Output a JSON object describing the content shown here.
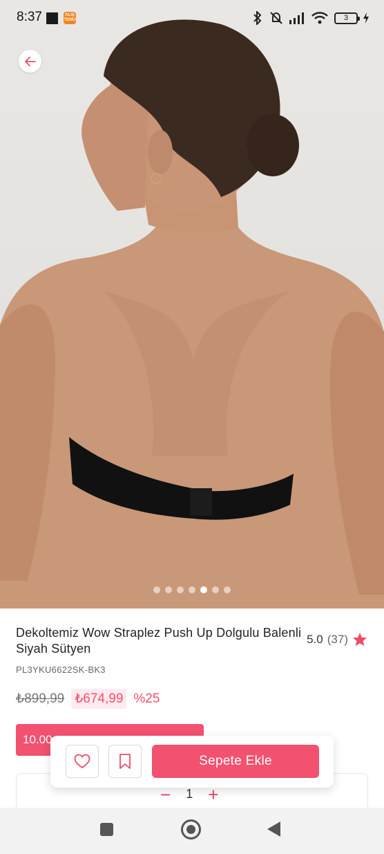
{
  "status_bar": {
    "time": "8:37",
    "app_badge": "ALIŞ TEMU",
    "battery": "3"
  },
  "gallery": {
    "image_count": 7,
    "active_index": 4
  },
  "product": {
    "title": "Dekoltemiz Wow Straplez Push Up Dolgulu Balenli Siyah Sütyen",
    "rating": "5.0",
    "review_count": "(37)",
    "sku": "PL3YKU6622SK-BK3",
    "old_price": "₺899,99",
    "new_price": "₺674,99",
    "discount": "%25",
    "campaign_label": "10.00",
    "campaign_faded": "  ··· ··· ·· ·",
    "quantity": "1",
    "qty_minus": "−",
    "qty_plus": "+"
  },
  "actions": {
    "add_to_cart": "Sepete Ekle"
  },
  "colors": {
    "accent": "#f2516f",
    "price_pink": "#ff4d6d",
    "star": "#ef4a68"
  }
}
